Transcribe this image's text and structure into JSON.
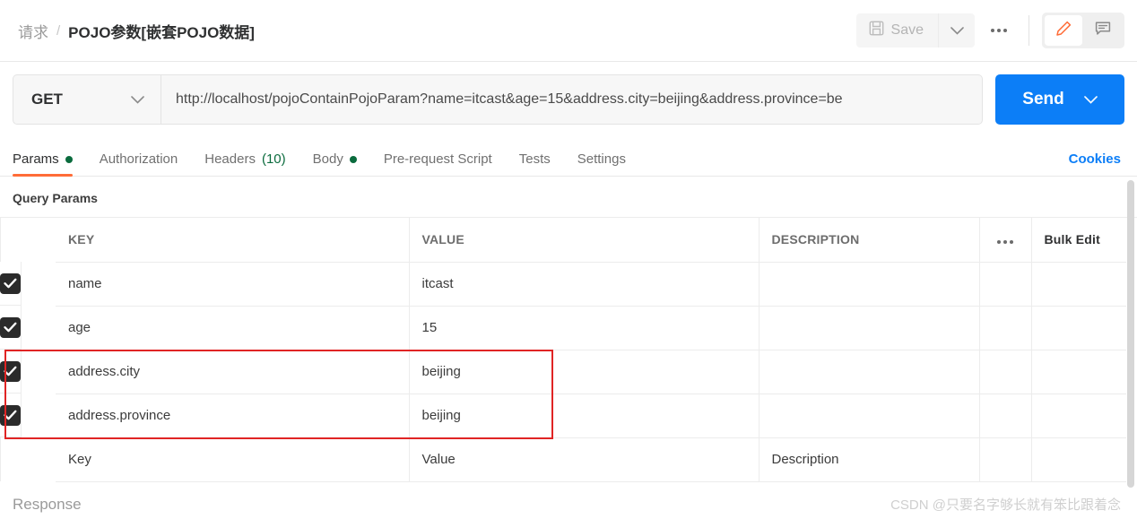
{
  "header": {
    "breadcrumb_parent": "请求",
    "breadcrumb_separator": "/",
    "breadcrumb_current": "POJO参数[嵌套POJO数据]",
    "save_label": "Save",
    "save_caret": "⌄",
    "more_icon": "ellipsis-icon",
    "edit_icon": "pencil-icon",
    "comment_icon": "comment-icon"
  },
  "request": {
    "method": "GET",
    "method_caret": "⌄",
    "url": "http://localhost/pojoContainPojoParam?name=itcast&age=15&address.city=beijing&address.province=be",
    "send_label": "Send",
    "send_caret": "⌄"
  },
  "tabs": [
    {
      "label": "Params",
      "dot": true,
      "count": "",
      "active": true
    },
    {
      "label": "Authorization",
      "dot": false,
      "count": "",
      "active": false
    },
    {
      "label": "Headers",
      "dot": false,
      "count": "(10)",
      "active": false
    },
    {
      "label": "Body",
      "dot": true,
      "count": "",
      "active": false
    },
    {
      "label": "Pre-request Script",
      "dot": false,
      "count": "",
      "active": false
    },
    {
      "label": "Tests",
      "dot": false,
      "count": "",
      "active": false
    },
    {
      "label": "Settings",
      "dot": false,
      "count": "",
      "active": false
    }
  ],
  "cookies_link": "Cookies",
  "params_section": {
    "title": "Query Params",
    "columns": {
      "key": "KEY",
      "value": "VALUE",
      "description": "DESCRIPTION",
      "bulk_edit": "Bulk Edit"
    },
    "rows": [
      {
        "checked": true,
        "key": "name",
        "value": "itcast",
        "description": ""
      },
      {
        "checked": true,
        "key": "age",
        "value": "15",
        "description": ""
      },
      {
        "checked": true,
        "key": "address.city",
        "value": "beijing",
        "description": ""
      },
      {
        "checked": true,
        "key": "address.province",
        "value": "beijing",
        "description": ""
      }
    ],
    "placeholder_row": {
      "key": "Key",
      "value": "Value",
      "description": "Description"
    },
    "annotation_color": "#e02424"
  },
  "footer": {
    "response_label": "Response",
    "watermark": "CSDN @只要名字够长就有笨比跟着念"
  },
  "colors": {
    "accent_orange": "#ff6c37",
    "send_blue": "#0c7ef7",
    "dot_green": "#0a6b3d",
    "link_blue": "#0c7ef7"
  }
}
